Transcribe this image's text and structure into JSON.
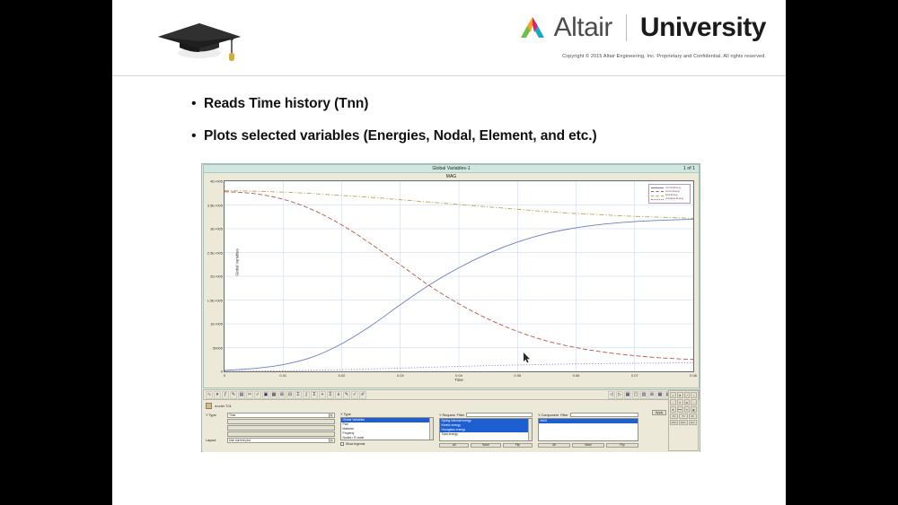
{
  "slide": {
    "brand": {
      "altair": "Altair",
      "university": "University",
      "separator": "|",
      "copyright": "Copyright © 2015 Altair Engineering, Inc. Proprietary and Confidential. All rights reserved."
    },
    "bullets": [
      {
        "marker": "•",
        "text": "Reads Time history (Tnn)"
      },
      {
        "marker": "•",
        "text": "Plots  selected variables (Energies, Nodal, Element, and etc.)"
      }
    ]
  },
  "app": {
    "plot": {
      "title": "Global Variables-1",
      "subtitle": "MAG",
      "page_indicator": "1 of 1",
      "legend": [
        {
          "label": "Internal Energy",
          "color": "#6a7fc0",
          "dash": "solid"
        },
        {
          "label": "Kinetic Energy",
          "color": "#b5564a",
          "dash": "dashed"
        },
        {
          "label": "Total Energy",
          "color": "#b9a45c",
          "dash": "dashdot"
        },
        {
          "label": "Hourglass Energy",
          "color": "#9a7fb5",
          "dash": "dotted"
        }
      ]
    },
    "file": {
      "name": "T01",
      "path": "model.T01"
    },
    "toolbar": {
      "left_icons": [
        "curve-icon",
        "dropdown-arrow-icon",
        "math-icon",
        "note-icon",
        "save-icon",
        "cut-icon",
        "check-icon",
        "page-icon",
        "table-icon",
        "grid-icon",
        "align-icon",
        "sum-icon",
        "integral-icon",
        "sigma-icon",
        "plus-icon",
        "sum2-icon",
        "peak-icon",
        "edit-icon",
        "apply-icon",
        "pen-icon"
      ],
      "right_icons": [
        "prev-icon",
        "next-icon",
        "page-layout-icon",
        "single-window-icon",
        "two-window-icon",
        "four-window-icon",
        "six-window-icon",
        "notes-icon",
        "flag-icon",
        "bulb-icon",
        "options-icon"
      ]
    },
    "panels": {
      "y_type": {
        "label": "Y Type",
        "value": "Time",
        "fields": [
          {
            "label": "",
            "value": "",
            "disabled": true
          },
          {
            "label": "",
            "value": "",
            "disabled": true
          },
          {
            "label": "",
            "value": "",
            "disabled": true
          }
        ],
        "layout_label": "Layout",
        "layout_value": "Use current plot"
      },
      "type_list": {
        "label": "Y Type",
        "items": [
          {
            "text": "Global Variables",
            "selected": true
          },
          {
            "text": "Part",
            "selected": false
          },
          {
            "text": "Material",
            "selected": false
          },
          {
            "text": "Property",
            "selected": false
          },
          {
            "text": "Nodes / R-node",
            "selected": false
          }
        ],
        "show_legend_label": "Show legends",
        "show_legend_checked": true
      },
      "request_list": {
        "label": "Y Request",
        "filter_label": "Filter",
        "filter_value": "",
        "items": [
          {
            "text": "Spring internal energy",
            "selected": true
          },
          {
            "text": "Kinetic energy",
            "selected": true
          },
          {
            "text": "Hourglass energy",
            "selected": true
          },
          {
            "text": "Total energy",
            "selected": false
          }
        ],
        "buttons": [
          "All",
          "None",
          "Flip"
        ]
      },
      "component_list": {
        "label": "Y Component",
        "filter_label": "Filter",
        "filter_value": "",
        "items": [
          {
            "text": "MAG",
            "selected": true
          }
        ],
        "buttons": [
          "All",
          "None",
          "Flip"
        ]
      },
      "apply_button": "Apply"
    },
    "right_grid": {
      "rows": [
        [
          "zoom-in-icon",
          "pan-icon",
          "fit-icon",
          "axes-icon"
        ],
        [
          "zoom-out-icon",
          "move-icon",
          "grid-icon",
          "scale-icon"
        ],
        [
          "crosshair-icon",
          "measure-icon",
          "note-icon",
          "color-icon"
        ]
      ],
      "fields": [
        [
          "X=",
          "Y=",
          "Z="
        ],
        [
          "Fit=",
          "Rs=",
          "Lb="
        ]
      ]
    }
  },
  "chart_data": {
    "type": "line",
    "title": "Global Variables-1",
    "subtitle": "MAG",
    "xlabel": "Time",
    "ylabel": "Global Variables",
    "xlim": [
      0,
      0.08
    ],
    "ylim": [
      0,
      400000
    ],
    "grid": true,
    "legend_position": "top-right",
    "x_ticks": [
      "0",
      "0.01",
      "0.02",
      "0.03",
      "0.04",
      "0.05",
      "0.06",
      "0.07",
      "0.08"
    ],
    "y_ticks": [
      "0",
      "50000",
      "1E+005",
      "1.5E+005",
      "2E+005",
      "2.5E+005",
      "3E+005",
      "3.5E+005",
      "4E+005"
    ],
    "x": [
      0,
      0.005,
      0.01,
      0.015,
      0.02,
      0.025,
      0.03,
      0.035,
      0.04,
      0.045,
      0.05,
      0.055,
      0.06,
      0.065,
      0.07,
      0.075,
      0.08
    ],
    "series": [
      {
        "name": "Internal Energy",
        "color": "#6a7fc0",
        "dash": "solid",
        "values": [
          2000,
          6000,
          14000,
          30000,
          58000,
          96000,
          140000,
          182000,
          218000,
          248000,
          272000,
          290000,
          302000,
          310000,
          315000,
          318000,
          320000
        ]
      },
      {
        "name": "Kinetic Energy",
        "color": "#b5564a",
        "dash": "dashed",
        "values": [
          378000,
          374000,
          362000,
          340000,
          308000,
          268000,
          224000,
          180000,
          142000,
          110000,
          84000,
          64000,
          50000,
          40000,
          33000,
          28000,
          25000
        ]
      },
      {
        "name": "Total Energy",
        "color": "#b9a45c",
        "dash": "dashdot",
        "values": [
          380000,
          379000,
          377000,
          374000,
          370000,
          366000,
          361000,
          356000,
          351000,
          346000,
          341000,
          336000,
          332000,
          329000,
          326000,
          324000,
          322000
        ]
      },
      {
        "name": "Hourglass Energy",
        "color": "#9a7fb5",
        "dash": "dotted",
        "values": [
          0,
          500,
          1200,
          2200,
          3500,
          5000,
          6800,
          8600,
          10400,
          12000,
          13400,
          14600,
          15600,
          16400,
          17000,
          17500,
          17900
        ]
      }
    ]
  }
}
